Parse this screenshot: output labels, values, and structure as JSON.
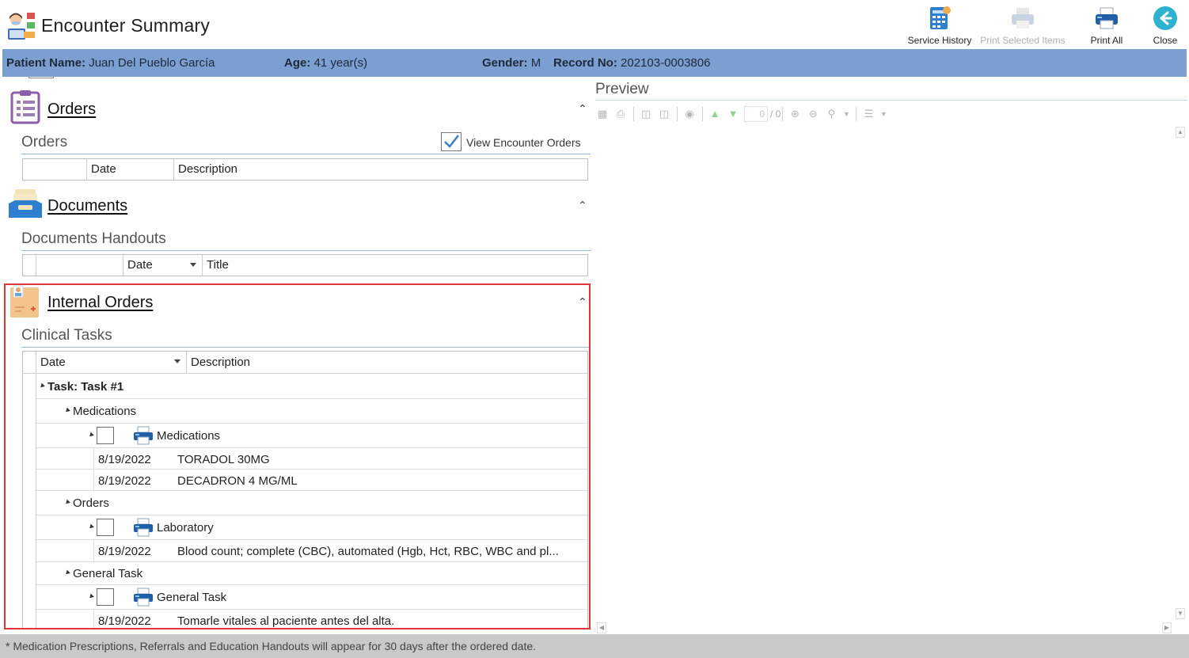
{
  "header": {
    "title": "Encounter Summary",
    "actions": {
      "service_history": "Service History",
      "print_selected": "Print Selected Items",
      "print_all": "Print All",
      "close": "Close"
    }
  },
  "patient": {
    "name_label": "Patient Name:",
    "name": "Juan Del Pueblo García",
    "age_label": "Age:",
    "age": "41 year(s)",
    "gender_label": "Gender:",
    "gender": "M",
    "record_label": "Record No:",
    "record": "202103-0003806"
  },
  "orders": {
    "title": "Orders",
    "subtitle": "Orders",
    "view_encounter_label": "View Encounter Orders",
    "view_encounter_checked": true,
    "columns": [
      "Date",
      "Description"
    ]
  },
  "documents": {
    "title": "Documents",
    "subtitle": "Documents Handouts",
    "columns": [
      "Date",
      "Title"
    ]
  },
  "internal_orders": {
    "title": "Internal Orders",
    "subtitle": "Clinical Tasks",
    "columns": [
      "Date",
      "Description"
    ],
    "task": "Task: Task #1",
    "groups": {
      "medications": {
        "label": "Medications",
        "item_label": "Medications",
        "rows": [
          {
            "date": "8/19/2022",
            "desc": "TORADOL 30MG"
          },
          {
            "date": "8/19/2022",
            "desc": "DECADRON 4 MG/ML"
          }
        ]
      },
      "orders": {
        "label": "Orders",
        "item_label": "Laboratory",
        "rows": [
          {
            "date": "8/19/2022",
            "desc": "Blood count; complete (CBC), automated (Hgb, Hct, RBC, WBC and pl..."
          }
        ]
      },
      "general": {
        "label": "General Task",
        "item_label": "General Task",
        "rows": [
          {
            "date": "8/19/2022",
            "desc": "Tomarle vitales al paciente antes del alta."
          }
        ]
      }
    }
  },
  "preview": {
    "title": "Preview",
    "page_current": "0",
    "page_total": "/ 0"
  },
  "footer": {
    "note": "* Medication Prescriptions, Referrals and Education Handouts will appear for 30 days after the ordered date."
  },
  "colors": {
    "patient_bar": "#7b9fd0",
    "highlight": "#e0353d",
    "footer": "#c9c9c9"
  },
  "icons": [
    "app-nurse-icon",
    "service-history-icon",
    "print-selected-icon",
    "print-all-icon",
    "close-back-icon",
    "orders-clipboard-icon",
    "documents-tray-icon",
    "internal-orders-folder-icon",
    "printer-icon"
  ]
}
